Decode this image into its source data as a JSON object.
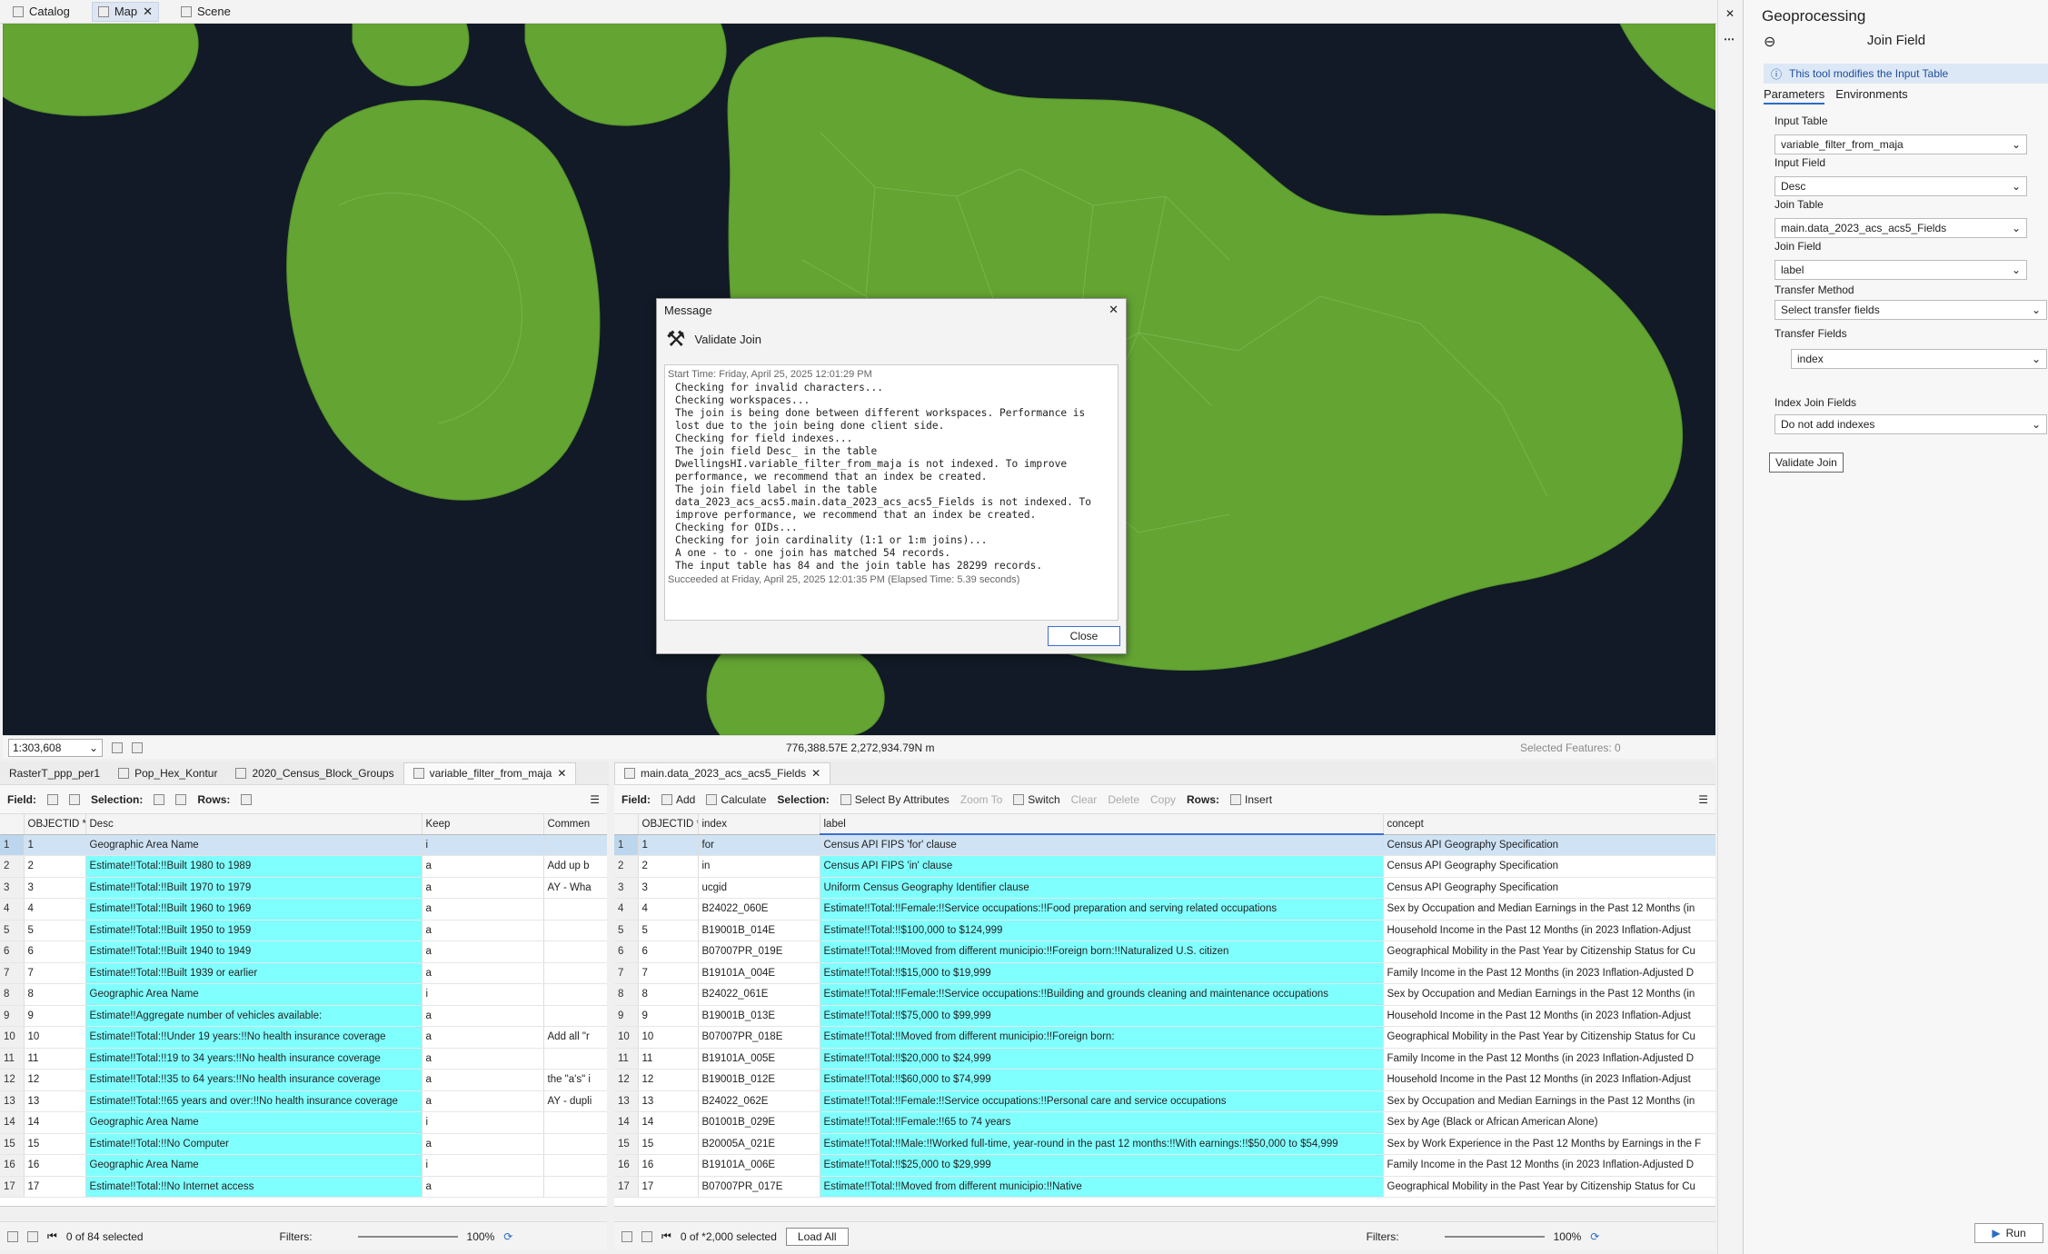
{
  "top_tabs": [
    {
      "label": "Catalog"
    },
    {
      "label": "Map"
    },
    {
      "label": "Scene"
    }
  ],
  "map": {
    "scale": "1:303,608",
    "coordinates": "776,388.57E 2,272,934.79N m",
    "selected_features": "Selected Features: 0",
    "land_color": "#63a433",
    "water_color": "#111a26"
  },
  "dialog": {
    "title": "Message",
    "heading": "Validate Join",
    "start_time": "Start Time: Friday, April 25, 2025 12:01:29 PM",
    "messages": "Checking for invalid characters...\nChecking workspaces...\nThe join is being done between different workspaces. Performance is\nlost due to the join being done client side.\nChecking for field indexes...\nThe join field Desc_ in the table\nDwellingsHI.variable_filter_from_maja is not indexed. To improve\nperformance, we recommend that an index be created.\nThe join field label in the table\ndata_2023_acs_acs5.main.data_2023_acs_acs5_Fields is not indexed. To\nimprove performance, we recommend that an index be created.\nChecking for OIDs...\nChecking for join cardinality (1:1 or 1:m joins)...\nA one - to - one join has matched 54 records.\nThe input table has 84 and the join table has 28299 records.",
    "succeeded": "Succeeded at Friday, April 25, 2025 12:01:35 PM (Elapsed Time: 5.39 seconds)",
    "close_label": "Close"
  },
  "left_tabs": [
    {
      "label": "RasterT_ppp_per1"
    },
    {
      "label": "Pop_Hex_Kontur"
    },
    {
      "label": "2020_Census_Block_Groups"
    },
    {
      "label": "variable_filter_from_maja"
    }
  ],
  "right_tabs": [
    {
      "label": "main.data_2023_acs_acs5_Fields"
    }
  ],
  "left_toolbar": {
    "field": "Field:",
    "selection": "Selection:",
    "rows": "Rows:"
  },
  "right_toolbar": {
    "field": "Field:",
    "add": "Add",
    "calculate": "Calculate",
    "selection": "Selection:",
    "select_by_attr": "Select By Attributes",
    "zoom_to": "Zoom To",
    "switch": "Switch",
    "clear": "Clear",
    "delete": "Delete",
    "copy": "Copy",
    "rows": "Rows:",
    "insert": "Insert"
  },
  "left_table": {
    "headers": [
      "OBJECTID *",
      "Desc",
      "Keep",
      "Commen"
    ],
    "rows": [
      [
        "1",
        "1",
        "Geographic Area Name",
        "i",
        ""
      ],
      [
        "2",
        "2",
        "Estimate!!Total:!!Built 1980 to 1989",
        "a",
        "Add up b"
      ],
      [
        "3",
        "3",
        "Estimate!!Total:!!Built 1970 to 1979",
        "a",
        "AY - Wha"
      ],
      [
        "4",
        "4",
        "Estimate!!Total:!!Built 1960 to 1969",
        "a",
        ""
      ],
      [
        "5",
        "5",
        "Estimate!!Total:!!Built 1950 to 1959",
        "a",
        ""
      ],
      [
        "6",
        "6",
        "Estimate!!Total:!!Built 1940 to 1949",
        "a",
        ""
      ],
      [
        "7",
        "7",
        "Estimate!!Total:!!Built 1939 or earlier",
        "a",
        ""
      ],
      [
        "8",
        "8",
        "Geographic Area Name",
        "i",
        ""
      ],
      [
        "9",
        "9",
        "Estimate!!Aggregate number of vehicles available:",
        "a",
        ""
      ],
      [
        "10",
        "10",
        "Estimate!!Total:!!Under 19 years:!!No health insurance coverage",
        "a",
        "Add all \"r"
      ],
      [
        "11",
        "11",
        "Estimate!!Total:!!19 to 34 years:!!No health insurance coverage",
        "a",
        ""
      ],
      [
        "12",
        "12",
        "Estimate!!Total:!!35 to 64 years:!!No health insurance coverage",
        "a",
        "the \"a's\" i"
      ],
      [
        "13",
        "13",
        "Estimate!!Total:!!65 years and over:!!No health insurance coverage",
        "a",
        "AY - dupli"
      ],
      [
        "14",
        "14",
        "Geographic Area Name",
        "i",
        ""
      ],
      [
        "15",
        "15",
        "Estimate!!Total:!!No Computer",
        "a",
        ""
      ],
      [
        "16",
        "16",
        "Geographic Area Name",
        "i",
        ""
      ],
      [
        "17",
        "17",
        "Estimate!!Total:!!No Internet access",
        "a",
        ""
      ]
    ]
  },
  "right_table": {
    "headers": [
      "OBJECTID *",
      "index",
      "label",
      "concept"
    ],
    "rows": [
      [
        "1",
        "1",
        "for",
        "Census API FIPS 'for' clause",
        "Census API Geography Specification"
      ],
      [
        "2",
        "2",
        "in",
        "Census API FIPS 'in' clause",
        "Census API Geography Specification"
      ],
      [
        "3",
        "3",
        "ucgid",
        "Uniform Census Geography Identifier clause",
        "Census API Geography Specification"
      ],
      [
        "4",
        "4",
        "B24022_060E",
        "Estimate!!Total:!!Female:!!Service occupations:!!Food preparation and serving related occupations",
        "Sex by Occupation and Median Earnings in the Past 12 Months (in"
      ],
      [
        "5",
        "5",
        "B19001B_014E",
        "Estimate!!Total:!!$100,000 to $124,999",
        "Household Income in the Past 12 Months (in 2023 Inflation-Adjust"
      ],
      [
        "6",
        "6",
        "B07007PR_019E",
        "Estimate!!Total:!!Moved from different municipio:!!Foreign born:!!Naturalized U.S. citizen",
        "Geographical Mobility in the Past Year by Citizenship Status for Cu"
      ],
      [
        "7",
        "7",
        "B19101A_004E",
        "Estimate!!Total:!!$15,000 to $19,999",
        "Family Income in the Past 12 Months (in 2023 Inflation-Adjusted D"
      ],
      [
        "8",
        "8",
        "B24022_061E",
        "Estimate!!Total:!!Female:!!Service occupations:!!Building and grounds cleaning and maintenance occupations",
        "Sex by Occupation and Median Earnings in the Past 12 Months (in"
      ],
      [
        "9",
        "9",
        "B19001B_013E",
        "Estimate!!Total:!!$75,000 to $99,999",
        "Household Income in the Past 12 Months (in 2023 Inflation-Adjust"
      ],
      [
        "10",
        "10",
        "B07007PR_018E",
        "Estimate!!Total:!!Moved from different municipio:!!Foreign born:",
        "Geographical Mobility in the Past Year by Citizenship Status for Cu"
      ],
      [
        "11",
        "11",
        "B19101A_005E",
        "Estimate!!Total:!!$20,000 to $24,999",
        "Family Income in the Past 12 Months (in 2023 Inflation-Adjusted D"
      ],
      [
        "12",
        "12",
        "B19001B_012E",
        "Estimate!!Total:!!$60,000 to $74,999",
        "Household Income in the Past 12 Months (in 2023 Inflation-Adjust"
      ],
      [
        "13",
        "13",
        "B24022_062E",
        "Estimate!!Total:!!Female:!!Service occupations:!!Personal care and service occupations",
        "Sex by Occupation and Median Earnings in the Past 12 Months (in"
      ],
      [
        "14",
        "14",
        "B01001B_029E",
        "Estimate!!Total:!!Female:!!65 to 74 years",
        "Sex by Age (Black or African American Alone)"
      ],
      [
        "15",
        "15",
        "B20005A_021E",
        "Estimate!!Total:!!Male:!!Worked full-time, year-round in the past 12 months:!!With earnings:!!$50,000 to $54,999",
        "Sex by Work Experience in the Past 12 Months by Earnings in the F"
      ],
      [
        "16",
        "16",
        "B19101A_006E",
        "Estimate!!Total:!!$25,000 to $29,999",
        "Family Income in the Past 12 Months (in 2023 Inflation-Adjusted D"
      ],
      [
        "17",
        "17",
        "B07007PR_017E",
        "Estimate!!Total:!!Moved from different municipio:!!Native",
        "Geographical Mobility in the Past Year by Citizenship Status for Cu"
      ]
    ]
  },
  "left_footer": {
    "selected": "0 of 84 selected",
    "filters": "Filters:",
    "zoom": "100%"
  },
  "right_footer": {
    "selected": "0 of *2,000 selected",
    "load_all": "Load All",
    "filters": "Filters:",
    "zoom": "100%"
  },
  "geoprocessing": {
    "title": "Geoprocessing",
    "tool": "Join Field",
    "info": "This tool modifies the Input Table",
    "tab_parameters": "Parameters",
    "tab_environments": "Environments",
    "params": [
      {
        "label": "Input Table",
        "value": "variable_filter_from_maja"
      },
      {
        "label": "Input Field",
        "value": "Desc"
      },
      {
        "label": "Join Table",
        "value": "main.data_2023_acs_acs5_Fields"
      },
      {
        "label": "Join Field",
        "value": "label"
      },
      {
        "label": "Transfer Method",
        "value": "Select transfer fields"
      },
      {
        "label": "Transfer Fields",
        "value": "index"
      },
      {
        "label": "Index Join Fields",
        "value": "Do not add indexes"
      }
    ],
    "validate_label": "Validate Join",
    "run_label": "Run"
  }
}
